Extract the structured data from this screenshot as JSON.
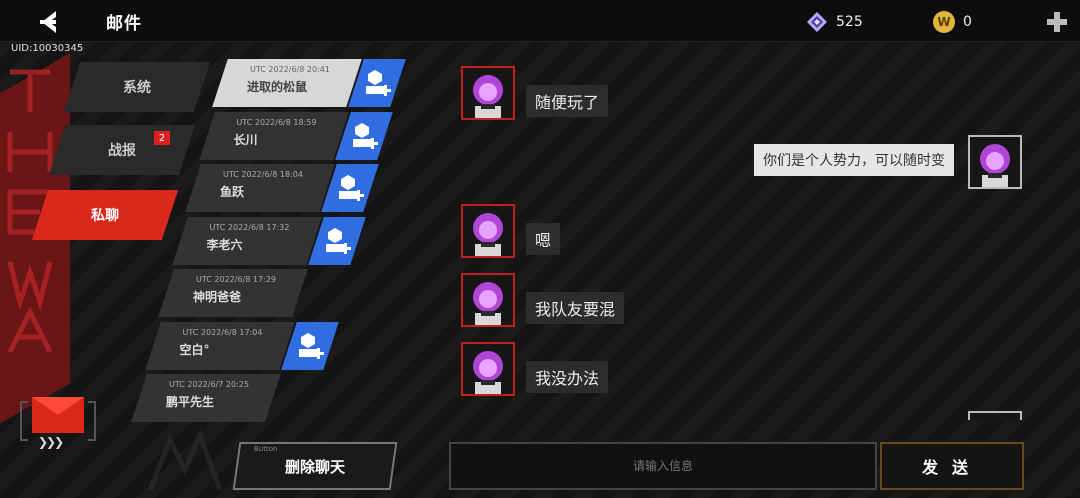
{
  "header": {
    "title": "邮件",
    "uid": "UID:10030345",
    "gems": "525",
    "coins": "0",
    "coin_glyph": "W"
  },
  "categories": [
    {
      "label": "系统"
    },
    {
      "label": "战报",
      "badge": "2"
    },
    {
      "label": "私聊",
      "active": true
    }
  ],
  "conversations": [
    {
      "time": "UTC 2022/6/8 20:41",
      "name": "进取的松鼠",
      "active": true,
      "add_friend": true
    },
    {
      "time": "UTC 2022/6/8 18:59",
      "name": "长川",
      "add_friend": true
    },
    {
      "time": "UTC 2022/6/8 18:04",
      "name": "鱼跃",
      "add_friend": true
    },
    {
      "time": "UTC 2022/6/8 17:32",
      "name": "李老六",
      "add_friend": true
    },
    {
      "time": "UTC 2022/6/8 17:29",
      "name": "神明爸爸",
      "add_friend": false
    },
    {
      "time": "UTC 2022/6/8 17:04",
      "name": "空白°",
      "add_friend": true
    },
    {
      "time": "UTC 2022/6/7 20:25",
      "name": "鹏平先生",
      "add_friend": false
    }
  ],
  "messages": [
    {
      "text": "随便玩了",
      "self": false
    },
    {
      "text": "你们是个人势力，可以随时变",
      "self": true
    },
    {
      "text": "嗯",
      "self": false
    },
    {
      "text": "我队友要混",
      "self": false
    },
    {
      "text": "我没办法",
      "self": false
    }
  ],
  "bottom": {
    "delete_small": "Button",
    "delete_label": "删除聊天",
    "input_placeholder": "请输入信息",
    "send_label": "发送"
  },
  "colors": {
    "accent_red": "#d9281c",
    "friend_blue": "#2f6de1",
    "send_border": "#6a4a1a"
  }
}
